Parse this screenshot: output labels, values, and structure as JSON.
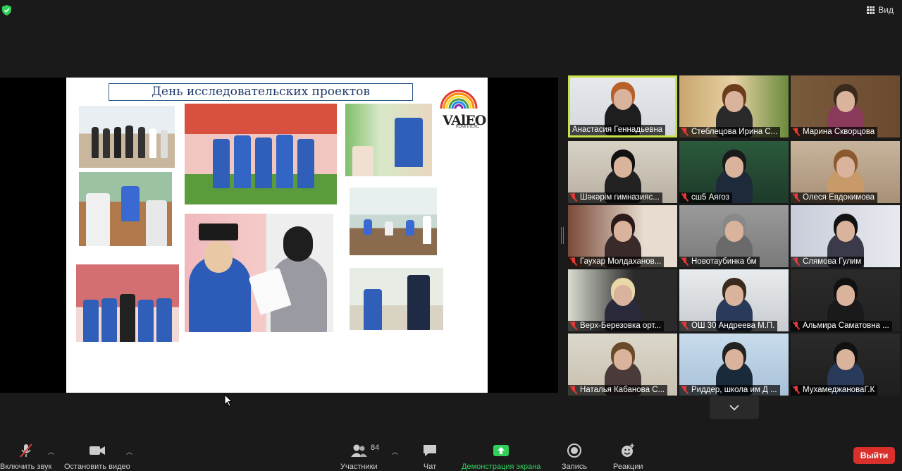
{
  "topbar": {
    "view_label": "Вид",
    "security_color": "#2fcf5a"
  },
  "slide": {
    "title": "День   исследовательских проектов",
    "logo_text": "VAlEO",
    "logo_sub": "КОМПЛЕКС"
  },
  "participants": [
    {
      "name": "Анастасия Геннадьевна",
      "muted": false,
      "active": true
    },
    {
      "name": "Стеблецова Ирина С...",
      "muted": true
    },
    {
      "name": "Марина Скворцова",
      "muted": true
    },
    {
      "name": "Шәкәрім гимназияс...",
      "muted": true
    },
    {
      "name": "сш5 Аягоз",
      "muted": true
    },
    {
      "name": "Олеся Евдокимова",
      "muted": true
    },
    {
      "name": "Гаухар Молдаханов...",
      "muted": true
    },
    {
      "name": "Новотаубинка бм",
      "muted": true
    },
    {
      "name": "Слямова Гулим",
      "muted": true
    },
    {
      "name": "Верх-Березовка орт...",
      "muted": true
    },
    {
      "name": "ОШ 30 Андреева М.П.",
      "muted": true
    },
    {
      "name": "Альмира Саматовна ...",
      "muted": true
    },
    {
      "name": "Наталья Кабанова С...",
      "muted": true
    },
    {
      "name": "Риддер, школа им Д ...",
      "muted": true
    },
    {
      "name": "МухамеджановаГ.К",
      "muted": true
    }
  ],
  "toolbar": {
    "unmute_label": "Включить звук",
    "stop_video_label": "Остановить видео",
    "participants_label": "Участники",
    "participants_count": "84",
    "chat_label": "Чат",
    "share_label": "Демонстрация экрана",
    "record_label": "Запись",
    "reactions_label": "Реакции",
    "leave_label": "Выйти"
  },
  "colors": {
    "leave": "#d9302c",
    "share": "#2fcf5a",
    "active_speaker": "#c8e04a",
    "muted": "#e53935"
  }
}
